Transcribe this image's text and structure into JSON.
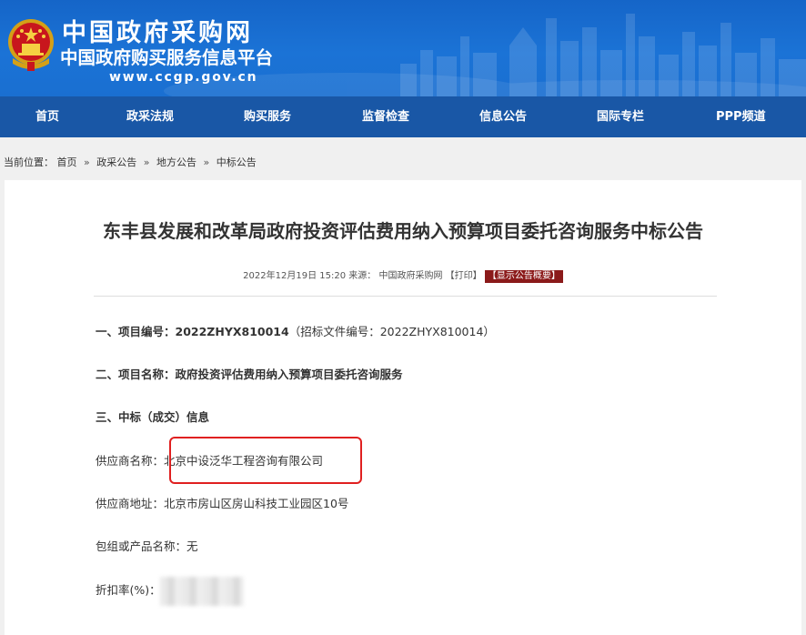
{
  "header": {
    "site_name": "中国政府采购网",
    "platform_name": "中国政府购买服务信息平台",
    "url": "www.ccgp.gov.cn"
  },
  "nav": {
    "items": [
      "首页",
      "政采法规",
      "购买服务",
      "监督检查",
      "信息公告",
      "国际专栏",
      "PPP频道"
    ]
  },
  "breadcrumb": {
    "label": "当前位置：",
    "items": [
      "首页",
      "政采公告",
      "地方公告",
      "中标公告"
    ],
    "separator": "»"
  },
  "article": {
    "title": "东丰县发展和改革局政府投资评估费用纳入预算项目委托咨询服务中标公告",
    "date": "2022年12月19日 15:20",
    "source_label": "来源：",
    "source": "中国政府采购网",
    "print_label": "【打印】",
    "summary_label": "【显示公告概要】",
    "project_no_label": "一、项目编号：",
    "project_no": "2022ZHYX810014",
    "tender_no_text": "（招标文件编号：2022ZHYX810014）",
    "project_name_label": "二、项目名称：",
    "project_name": "政府投资评估费用纳入预算项目委托咨询服务",
    "section3": "三、中标（成交）信息",
    "supplier_name_label": "供应商名称：",
    "supplier_name": "北京中设泛华工程咨询有限公司",
    "supplier_addr_label": "供应商地址：",
    "supplier_addr": "北京市房山区房山科技工业园区10号",
    "package_label": "包组或产品名称：",
    "package_value": "无",
    "discount_label": "折扣率(%)："
  },
  "colors": {
    "banner": "#1b73d6",
    "nav": "#1957a6",
    "badge": "#8b1a1a",
    "highlight": "#e02020"
  }
}
